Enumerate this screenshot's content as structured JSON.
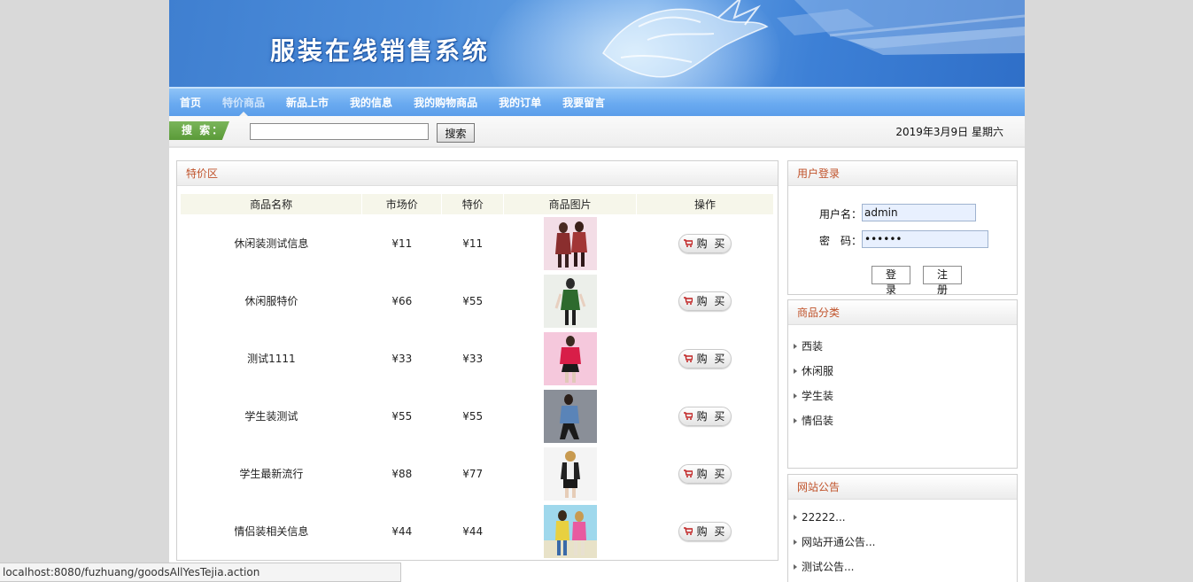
{
  "banner": {
    "title": "服装在线销售系统"
  },
  "nav": {
    "items": [
      {
        "label": "首页"
      },
      {
        "label": "特价商品"
      },
      {
        "label": "新品上市"
      },
      {
        "label": "我的信息"
      },
      {
        "label": "我的购物商品"
      },
      {
        "label": "我的订单"
      },
      {
        "label": "我要留言"
      }
    ],
    "active": "特价商品"
  },
  "search": {
    "label": "搜 索：",
    "value": "",
    "button": "搜索"
  },
  "date": "2019年3月9日 星期六",
  "special": {
    "title": "特价区",
    "columns": [
      "商品名称",
      "市场价",
      "特价",
      "商品图片",
      "操作"
    ],
    "rows": [
      {
        "name": "休闲装测试信息",
        "market": "¥11",
        "price": "¥11",
        "action": "购 买"
      },
      {
        "name": "休闲服特价",
        "market": "¥66",
        "price": "¥55",
        "action": "购 买"
      },
      {
        "name": "测试1111",
        "market": "¥33",
        "price": "¥33",
        "action": "购 买"
      },
      {
        "name": "学生装测试",
        "market": "¥55",
        "price": "¥55",
        "action": "购 买"
      },
      {
        "name": "学生最新流行",
        "market": "¥88",
        "price": "¥77",
        "action": "购 买"
      },
      {
        "name": "情侣装相关信息",
        "market": "¥44",
        "price": "¥44",
        "action": "购 买"
      }
    ]
  },
  "login": {
    "title": "用户登录",
    "username_label": "用户名：",
    "username_value": "admin",
    "password_label": "密　码：",
    "password_value": "••••••",
    "login_button": "登 录",
    "register_button": "注 册"
  },
  "categories": {
    "title": "商品分类",
    "items": [
      "西装",
      "休闲服",
      "学生装",
      "情侣装"
    ]
  },
  "notices": {
    "title": "网站公告",
    "items": [
      "22222...",
      "网站开通公告...",
      "测试公告..."
    ]
  },
  "statusbar": {
    "url": "localhost:8080/fuzhuang/goodsAllYesTejia.action"
  }
}
